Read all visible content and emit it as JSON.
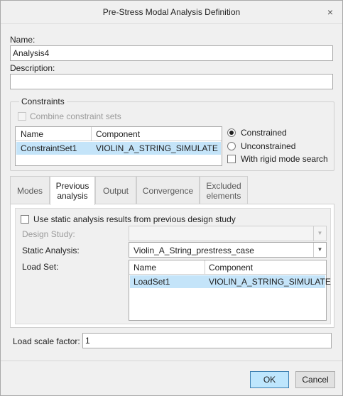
{
  "window": {
    "title": "Pre-Stress Modal Analysis Definition",
    "close_glyph": "×"
  },
  "name": {
    "label": "Name:",
    "value": "Analysis4"
  },
  "description": {
    "label": "Description:",
    "value": ""
  },
  "constraints": {
    "group_title": "Constraints",
    "combine_label": "Combine constraint sets",
    "columns": [
      "Name",
      "Component"
    ],
    "rows": [
      {
        "name": "ConstraintSet1",
        "component": "VIOLIN_A_STRING_SIMULATE"
      }
    ],
    "radio_constrained": "Constrained",
    "radio_unconstrained": "Unconstrained",
    "rigid_mode_label": "With rigid mode search"
  },
  "tabs": [
    {
      "label": "Modes"
    },
    {
      "label": "Previous\nanalysis"
    },
    {
      "label": "Output"
    },
    {
      "label": "Convergence"
    },
    {
      "label": "Excluded\nelements"
    }
  ],
  "previous_analysis": {
    "use_static_label": "Use static analysis results from previous design study",
    "design_study_label": "Design Study:",
    "design_study_value": "",
    "static_analysis_label": "Static Analysis:",
    "static_analysis_value": "Violin_A_String_prestress_case",
    "load_set_label": "Load Set:",
    "load_columns": [
      "Name",
      "Component"
    ],
    "load_rows": [
      {
        "name": "LoadSet1",
        "component": "VIOLIN_A_STRING_SIMULATE"
      }
    ]
  },
  "load_scale": {
    "label": "Load scale factor:",
    "value": "1"
  },
  "buttons": {
    "ok": "OK",
    "cancel": "Cancel"
  },
  "colors": {
    "selection": "#c4e4f9",
    "default_button": "#bee6fd"
  }
}
